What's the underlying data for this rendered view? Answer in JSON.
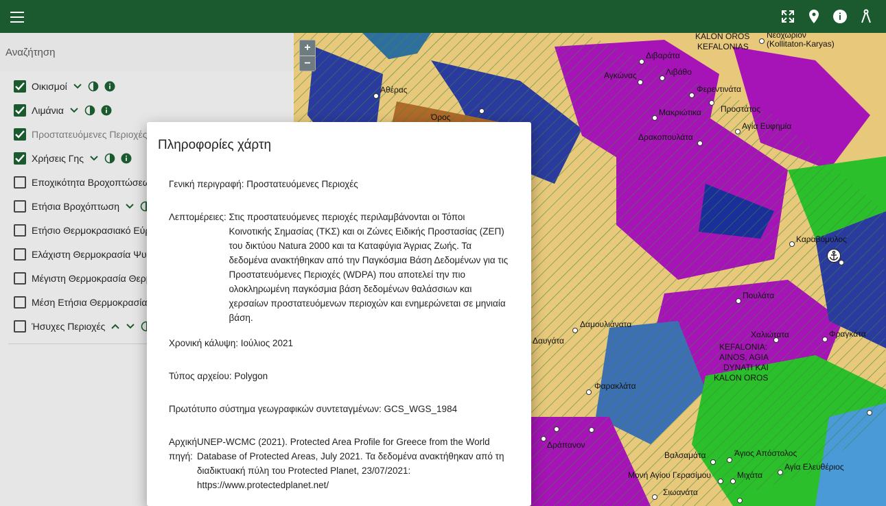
{
  "topbar": {
    "icons": [
      "menu-icon",
      "fullscreen-icon",
      "location-icon",
      "info-icon",
      "measure-icon"
    ],
    "color": "#1a5a2e"
  },
  "sidebar": {
    "search_placeholder": "Αναζήτηση",
    "layers": [
      {
        "label": "Οικισμοί",
        "checked": true,
        "dim": false
      },
      {
        "label": "Λιμάνια",
        "checked": true,
        "dim": false
      },
      {
        "label": "Προστατευόμενες Περιοχές",
        "checked": true,
        "dim": true
      },
      {
        "label": "Χρήσεις Γης",
        "checked": true,
        "dim": false
      },
      {
        "label": "Εποχικότητα Βροχοπτώσεων",
        "checked": false,
        "dim": false
      },
      {
        "label": "Ετήσια Βροχόπτωση",
        "checked": false,
        "dim": false
      },
      {
        "label": "Ετήσιο Θερμοκρασιακό Εύρος",
        "checked": false,
        "dim": false
      },
      {
        "label": "Ελάχιστη Θερμοκρασία Ψυχρότερου Μήνα",
        "checked": false,
        "dim": false
      },
      {
        "label": "Μέγιστη Θερμοκρασία Θερμότερου Μήνα",
        "checked": false,
        "dim": false
      },
      {
        "label": "Μέση Ετήσια Θερμοκρασία",
        "checked": false,
        "dim": false
      },
      {
        "label": "Ήσυχες Περιοχές",
        "checked": false,
        "dim": false
      }
    ]
  },
  "map": {
    "zoom_in": "+",
    "zoom_out": "−",
    "places": [
      {
        "name": "KALON OROS",
        "k": "p1"
      },
      {
        "name": "KEFALONIAS",
        "k": "p2"
      },
      {
        "name": "Νεοχώριον",
        "k": "p3"
      },
      {
        "name": "(Kollitaton-Karyas)",
        "k": "p4"
      },
      {
        "name": "Διβαράτα",
        "k": "p5"
      },
      {
        "name": "Αγκώνας",
        "k": "p6"
      },
      {
        "name": "Λιβάθο",
        "k": "p7"
      },
      {
        "name": "Αθέρας",
        "k": "p8"
      },
      {
        "name": "Φερεντινάτα",
        "k": "p9"
      },
      {
        "name": "Μακριώτικα",
        "k": "p10"
      },
      {
        "name": "Προστάτος",
        "k": "p11"
      },
      {
        "name": "Αγία Ευφημία",
        "k": "p12"
      },
      {
        "name": "Δρακοπουλάτα",
        "k": "p13"
      },
      {
        "name": "Καραβόμυλος",
        "k": "p14"
      },
      {
        "name": "Πουλάτα",
        "k": "p15"
      },
      {
        "name": "Χαλιώτατα",
        "k": "p16"
      },
      {
        "name": "KEFALONIA:",
        "k": "p17"
      },
      {
        "name": "AINOS, AGIA",
        "k": "p18"
      },
      {
        "name": "DYNATI KAI",
        "k": "p19"
      },
      {
        "name": "KALON OROS",
        "k": "p20"
      },
      {
        "name": "Δαμουλιάνατα",
        "k": "p21"
      },
      {
        "name": "Δαυγάτα",
        "k": "p22"
      },
      {
        "name": "Φαρακλάτα",
        "k": "p23"
      },
      {
        "name": "Δράπανον",
        "k": "p24"
      },
      {
        "name": "Βαλσαμάτα",
        "k": "p25"
      },
      {
        "name": "Άγιος Απόστολος",
        "k": "p26"
      },
      {
        "name": "Αγία Ελευθέριος",
        "k": "p27"
      },
      {
        "name": "Μονή Αγίου Γερασίμου",
        "k": "p28"
      },
      {
        "name": "Μιχάτα",
        "k": "p29"
      },
      {
        "name": "Φραγκάτα",
        "k": "p30"
      },
      {
        "name": "Σιωανάτα",
        "k": "p31"
      },
      {
        "name": "Όρος",
        "k": "p32"
      }
    ]
  },
  "modal": {
    "title": "Πληροφορίες χάρτη",
    "rows": [
      {
        "key": "Γενική περιγραφή: ",
        "value": "Προστατευόμενες Περιοχές"
      },
      {
        "key": "Λεπτομέρειες: ",
        "value": "Στις προστατευόμενες περιοχές περιλαμβάνονται οι Τόποι Κοινοτικής Σημασίας (ΤΚΣ) και οι Ζώνες Ειδικής Προστασίας (ΖΕΠ) του δικτύου Natura 2000 και τα Καταφύγια Άγριας Ζωής. Τα δεδομένα ανακτήθηκαν από την Παγκόσμια Βάση Δεδομένων για τις Προστατευόμενες Περιοχές (WDPA) που αποτελεί την πιο ολοκληρωμένη παγκόσμια βάση δεδομένων θαλάσσιων και χερσαίων προστατευόμενων περιοχών και ενημερώνεται σε μηνιαία βάση."
      },
      {
        "key": "Χρονική κάλυψη: ",
        "value": "Ιούλιος 2021"
      },
      {
        "key": "Τύπος αρχείου: ",
        "value": "Polygon"
      },
      {
        "key": "Πρωτότυπο σύστημα γεωγραφικών συντεταγμένων: ",
        "value": "GCS_WGS_1984"
      },
      {
        "key": "Αρχική\nπηγή: ",
        "value": "UNEP-WCMC (2021). Protected Area Profile for Greece from the World Database of Protected Areas, July 2021. Τα δεδομένα ανακτήθηκαν από τη διαδικτυακή πύλη του Protected Planet, 23/07/2021: https://www.protectedplanet.net/"
      }
    ]
  }
}
